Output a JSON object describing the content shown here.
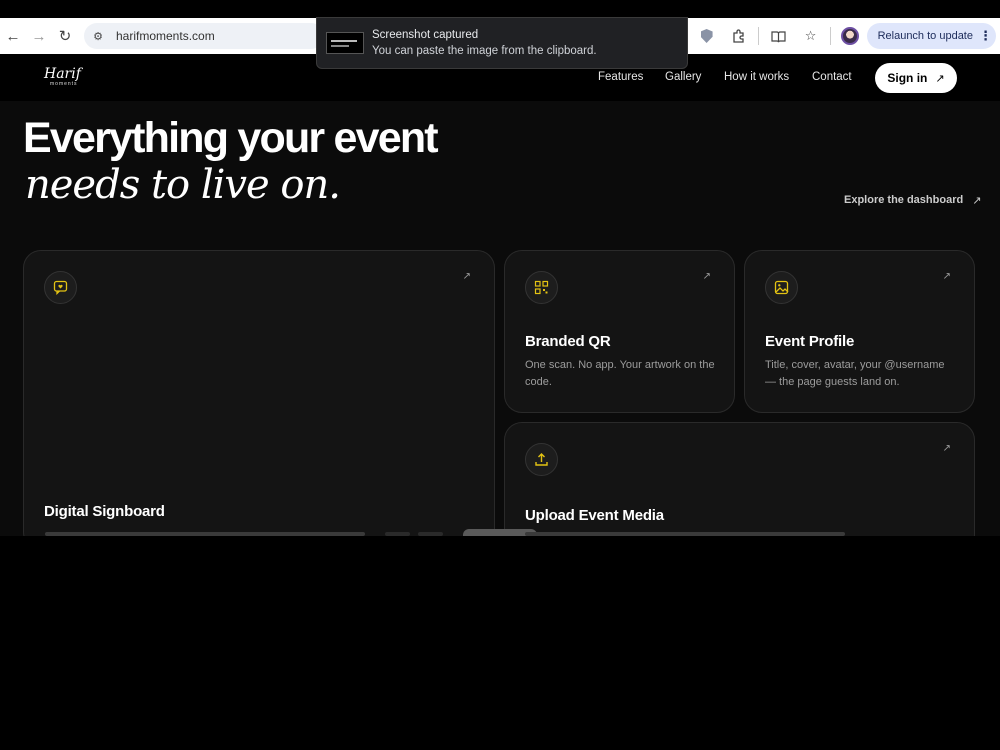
{
  "browser": {
    "url": "harifmoments.com",
    "relaunch_label": "Relaunch to update",
    "toolbar_icons": [
      "back-icon",
      "forward-icon",
      "reload-icon",
      "site-settings-icon",
      "extension-red-icon",
      "extension-green-icon",
      "extension-shield-icon",
      "extensions-puzzle-icon",
      "reading-mode-icon",
      "bookmark-star-icon",
      "profile-avatar"
    ]
  },
  "toast": {
    "title": "Screenshot captured",
    "body": "You can paste the image from the clipboard."
  },
  "site": {
    "logo_script": "Harif",
    "logo_sub": "moments",
    "nav": [
      {
        "label": "Features"
      },
      {
        "label": "Gallery"
      },
      {
        "label": "How it works"
      },
      {
        "label": "Contact"
      }
    ],
    "signin_label": "Sign in",
    "hero_line1": "Everything your event",
    "hero_line2": "needs to live on.",
    "explore_label": "Explore the dashboard",
    "cards": [
      {
        "title": "Digital Signboard",
        "desc": "",
        "icon": "message-heart-icon"
      },
      {
        "title": "Branded QR",
        "desc": "One scan. No app. Your artwork on the code.",
        "icon": "qr-code-icon"
      },
      {
        "title": "Event Profile",
        "desc": "Title, cover, avatar, your @username — the page guests land on.",
        "icon": "image-icon"
      },
      {
        "title": "Upload Event Media",
        "desc": "",
        "icon": "upload-icon"
      }
    ]
  },
  "colors": {
    "accent": "#e4c313",
    "page_bg": "#0b0b0b",
    "card_bg": "#141414",
    "relaunch_bg": "#dfe6fb"
  }
}
